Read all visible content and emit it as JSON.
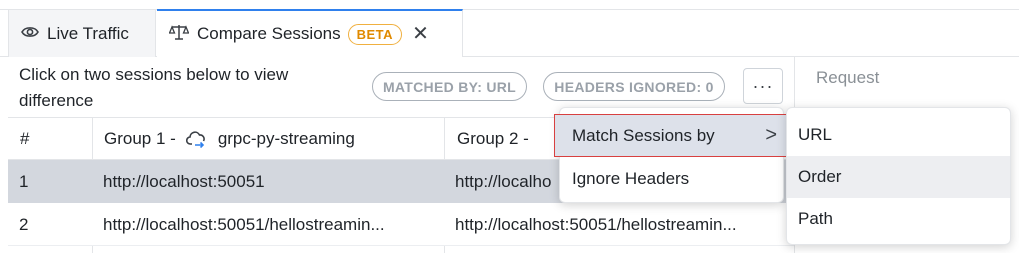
{
  "tabs": [
    {
      "label": "Live Traffic",
      "icon": "eye-icon"
    },
    {
      "label": "Compare Sessions",
      "icon": "scale-icon",
      "badge": "BETA",
      "close": "✕"
    }
  ],
  "toolbar": {
    "hint": "Click on two sessions below to view difference",
    "matched_by": "MATCHED BY: URL",
    "headers_ignored": "HEADERS IGNORED: 0",
    "more": "···"
  },
  "request_panel": {
    "title": "Request"
  },
  "table": {
    "headers": {
      "num": "#",
      "group1_prefix": "Group 1 -",
      "group1_name": "grpc-py-streaming",
      "group2_prefix": "Group 2 -"
    },
    "rows": [
      {
        "num": "1",
        "g1": "http://localhost:50051",
        "g2": "http://localho"
      },
      {
        "num": "2",
        "g1": "http://localhost:50051/hellostreamin...",
        "g2": "http://localhost:50051/hellostreamin..."
      }
    ]
  },
  "menu": {
    "items": [
      {
        "label": "Match Sessions by",
        "chevron": ">"
      },
      {
        "label": "Ignore Headers"
      }
    ]
  },
  "submenu": {
    "items": [
      {
        "label": "URL"
      },
      {
        "label": "Order"
      },
      {
        "label": "Path"
      }
    ]
  },
  "colors": {
    "accent": "#2f80ed",
    "beta": "#e08a00",
    "selected_row": "#d3d7de",
    "highlight_outline": "#d84040"
  }
}
